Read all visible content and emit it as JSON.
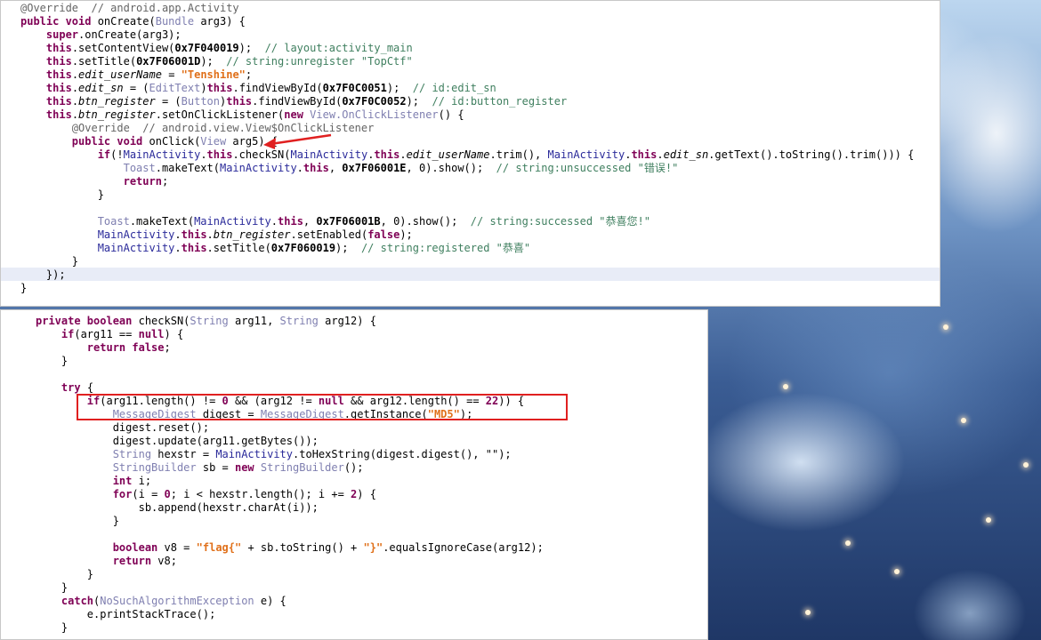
{
  "top_code": {
    "lines": [
      [
        [
          "ann",
          "@Override  // android.app.Activity"
        ]
      ],
      [
        [
          "kw",
          "public void "
        ],
        [
          "",
          "onCreate("
        ],
        [
          "ty",
          "Bundle"
        ],
        [
          "",
          " arg3) {"
        ]
      ],
      [
        [
          "",
          "    "
        ],
        [
          "kw",
          "super"
        ],
        [
          "",
          ".onCreate(arg3);"
        ]
      ],
      [
        [
          "",
          "    "
        ],
        [
          "kw",
          "this"
        ],
        [
          "",
          ".setContentView("
        ],
        [
          "hx",
          "0x7F040019"
        ],
        [
          "",
          ");  "
        ],
        [
          "cm",
          "// layout:activity_main"
        ]
      ],
      [
        [
          "",
          "    "
        ],
        [
          "kw",
          "this"
        ],
        [
          "",
          ".setTitle("
        ],
        [
          "hx",
          "0x7F06001D"
        ],
        [
          "",
          ");  "
        ],
        [
          "cm",
          "// string:unregister \"TopCtf\""
        ]
      ],
      [
        [
          "",
          "    "
        ],
        [
          "kw",
          "this"
        ],
        [
          "",
          "."
        ],
        [
          "fld",
          "edit_userName"
        ],
        [
          "",
          " = "
        ],
        [
          "st-b",
          "\"Tenshine\""
        ],
        [
          "",
          ";"
        ]
      ],
      [
        [
          "",
          "    "
        ],
        [
          "kw",
          "this"
        ],
        [
          "",
          "."
        ],
        [
          "fld",
          "edit_sn"
        ],
        [
          "",
          " = ("
        ],
        [
          "ty",
          "EditText"
        ],
        [
          "",
          ")"
        ],
        [
          "kw",
          "this"
        ],
        [
          "",
          ".findViewById("
        ],
        [
          "hx",
          "0x7F0C0051"
        ],
        [
          "",
          ");  "
        ],
        [
          "cm",
          "// id:edit_sn"
        ]
      ],
      [
        [
          "",
          "    "
        ],
        [
          "kw",
          "this"
        ],
        [
          "",
          "."
        ],
        [
          "fld",
          "btn_register"
        ],
        [
          "",
          " = ("
        ],
        [
          "ty",
          "Button"
        ],
        [
          "",
          ")"
        ],
        [
          "kw",
          "this"
        ],
        [
          "",
          ".findViewById("
        ],
        [
          "hx",
          "0x7F0C0052"
        ],
        [
          "",
          ");  "
        ],
        [
          "cm",
          "// id:button_register"
        ]
      ],
      [
        [
          "",
          "    "
        ],
        [
          "kw",
          "this"
        ],
        [
          "",
          "."
        ],
        [
          "fld",
          "btn_register"
        ],
        [
          "",
          ".setOnClickListener("
        ],
        [
          "kw",
          "new "
        ],
        [
          "ty",
          "View.OnClickListener"
        ],
        [
          "",
          "() {"
        ]
      ],
      [
        [
          "",
          "        "
        ],
        [
          "ann",
          "@Override  // android.view.View$OnClickListener"
        ]
      ],
      [
        [
          "",
          "        "
        ],
        [
          "kw",
          "public void "
        ],
        [
          "",
          "onClick("
        ],
        [
          "ty",
          "View"
        ],
        [
          "",
          " arg5) {"
        ]
      ],
      [
        [
          "",
          "            "
        ],
        [
          "kw",
          "if"
        ],
        [
          "",
          "(!"
        ],
        [
          "cl",
          "MainActivity"
        ],
        [
          "",
          "."
        ],
        [
          "kw",
          "this"
        ],
        [
          "",
          ".checkSN("
        ],
        [
          "cl",
          "MainActivity"
        ],
        [
          "",
          "."
        ],
        [
          "kw",
          "this"
        ],
        [
          "",
          "."
        ],
        [
          "fld",
          "edit_userName"
        ],
        [
          "",
          ".trim(), "
        ],
        [
          "cl",
          "MainActivity"
        ],
        [
          "",
          "."
        ],
        [
          "kw",
          "this"
        ],
        [
          "",
          "."
        ],
        [
          "fld",
          "edit_sn"
        ],
        [
          "",
          ".getText().toString().trim())) {"
        ]
      ],
      [
        [
          "",
          "                "
        ],
        [
          "ty",
          "Toast"
        ],
        [
          "",
          ".makeText("
        ],
        [
          "cl",
          "MainActivity"
        ],
        [
          "",
          "."
        ],
        [
          "kw",
          "this"
        ],
        [
          "",
          ", "
        ],
        [
          "hx",
          "0x7F06001E"
        ],
        [
          "",
          ", 0).show();  "
        ],
        [
          "cm",
          "// string:unsuccessed \"错误!\""
        ]
      ],
      [
        [
          "",
          "                "
        ],
        [
          "kw",
          "return"
        ],
        [
          "",
          ";"
        ]
      ],
      [
        [
          "",
          "            }"
        ]
      ],
      [
        [
          "",
          ""
        ]
      ],
      [
        [
          "",
          "            "
        ],
        [
          "ty",
          "Toast"
        ],
        [
          "",
          ".makeText("
        ],
        [
          "cl",
          "MainActivity"
        ],
        [
          "",
          "."
        ],
        [
          "kw",
          "this"
        ],
        [
          "",
          ", "
        ],
        [
          "hx",
          "0x7F06001B"
        ],
        [
          "",
          ", 0).show();  "
        ],
        [
          "cm",
          "// string:successed \"恭喜您!\""
        ]
      ],
      [
        [
          "",
          "            "
        ],
        [
          "cl",
          "MainActivity"
        ],
        [
          "",
          "."
        ],
        [
          "kw",
          "this"
        ],
        [
          "",
          "."
        ],
        [
          "fld",
          "btn_register"
        ],
        [
          "",
          ".setEnabled("
        ],
        [
          "kw",
          "false"
        ],
        [
          "",
          ");"
        ]
      ],
      [
        [
          "",
          "            "
        ],
        [
          "cl",
          "MainActivity"
        ],
        [
          "",
          "."
        ],
        [
          "kw",
          "this"
        ],
        [
          "",
          ".setTitle("
        ],
        [
          "hx",
          "0x7F060019"
        ],
        [
          "",
          ");  "
        ],
        [
          "cm",
          "// string:registered \"恭喜\""
        ]
      ],
      [
        [
          "",
          "        }"
        ]
      ],
      [
        [
          "",
          "    });"
        ]
      ],
      [
        [
          "",
          "}"
        ]
      ]
    ]
  },
  "bottom_code": {
    "lines": [
      [
        [
          "kw",
          "private boolean "
        ],
        [
          "",
          "checkSN("
        ],
        [
          "ty",
          "String"
        ],
        [
          "",
          " arg11, "
        ],
        [
          "ty",
          "String"
        ],
        [
          "",
          " arg12) {"
        ]
      ],
      [
        [
          "",
          "    "
        ],
        [
          "kw",
          "if"
        ],
        [
          "",
          "(arg11 == "
        ],
        [
          "kw",
          "null"
        ],
        [
          "",
          ") {"
        ]
      ],
      [
        [
          "",
          "        "
        ],
        [
          "kw",
          "return false"
        ],
        [
          "",
          ";"
        ]
      ],
      [
        [
          "",
          "    }"
        ]
      ],
      [
        [
          "",
          ""
        ]
      ],
      [
        [
          "",
          "    "
        ],
        [
          "kw",
          "try"
        ],
        [
          "",
          " {"
        ]
      ],
      [
        [
          "",
          "        "
        ],
        [
          "kw",
          "if"
        ],
        [
          "",
          "(arg11.length() != "
        ],
        [
          "kw",
          "0"
        ],
        [
          "",
          " && (arg12 != "
        ],
        [
          "kw",
          "null"
        ],
        [
          "",
          " && arg12.length() == "
        ],
        [
          "kw",
          "22"
        ],
        [
          "",
          ")) {"
        ]
      ],
      [
        [
          "",
          "            "
        ],
        [
          "ty",
          "MessageDigest"
        ],
        [
          "",
          " digest = "
        ],
        [
          "ty",
          "MessageDigest"
        ],
        [
          "",
          ".getInstance("
        ],
        [
          "st-b",
          "\"MD5\""
        ],
        [
          "",
          ");"
        ]
      ],
      [
        [
          "",
          "            digest.reset();"
        ]
      ],
      [
        [
          "",
          "            digest.update(arg11.getBytes());"
        ]
      ],
      [
        [
          "",
          "            "
        ],
        [
          "ty",
          "String"
        ],
        [
          "",
          " hexstr = "
        ],
        [
          "cl",
          "MainActivity"
        ],
        [
          "",
          ".toHexString(digest.digest(), \"\");"
        ]
      ],
      [
        [
          "",
          "            "
        ],
        [
          "ty",
          "StringBuilder"
        ],
        [
          "",
          " sb = "
        ],
        [
          "kw",
          "new "
        ],
        [
          "ty",
          "StringBuilder"
        ],
        [
          "",
          "();"
        ]
      ],
      [
        [
          "",
          "            "
        ],
        [
          "kw",
          "int"
        ],
        [
          "",
          " i;"
        ]
      ],
      [
        [
          "",
          "            "
        ],
        [
          "kw",
          "for"
        ],
        [
          "",
          "(i = "
        ],
        [
          "kw",
          "0"
        ],
        [
          "",
          "; i < hexstr.length(); i += "
        ],
        [
          "kw",
          "2"
        ],
        [
          "",
          ") {"
        ]
      ],
      [
        [
          "",
          "                sb.append(hexstr.charAt(i));"
        ]
      ],
      [
        [
          "",
          "            }"
        ]
      ],
      [
        [
          "",
          ""
        ]
      ],
      [
        [
          "",
          "            "
        ],
        [
          "kw",
          "boolean"
        ],
        [
          "",
          " v8 = "
        ],
        [
          "st-b",
          "\"flag{\""
        ],
        [
          "",
          " + sb.toString() + "
        ],
        [
          "st-b",
          "\"}\""
        ],
        [
          "",
          ".equalsIgnoreCase(arg12);"
        ]
      ],
      [
        [
          "",
          "            "
        ],
        [
          "kw",
          "return"
        ],
        [
          "",
          " v8;"
        ]
      ],
      [
        [
          "",
          "        }"
        ]
      ],
      [
        [
          "",
          "    }"
        ]
      ],
      [
        [
          "",
          "    "
        ],
        [
          "kw",
          "catch"
        ],
        [
          "",
          "("
        ],
        [
          "ty",
          "NoSuchAlgorithmException"
        ],
        [
          "",
          " e) {"
        ]
      ],
      [
        [
          "",
          "        e.printStackTrace();"
        ]
      ],
      [
        [
          "",
          "    }"
        ]
      ]
    ]
  },
  "colors": {
    "annotation_box": "#e02020",
    "arrow": "#e02020",
    "highlight_line": "#e8ecf7"
  }
}
